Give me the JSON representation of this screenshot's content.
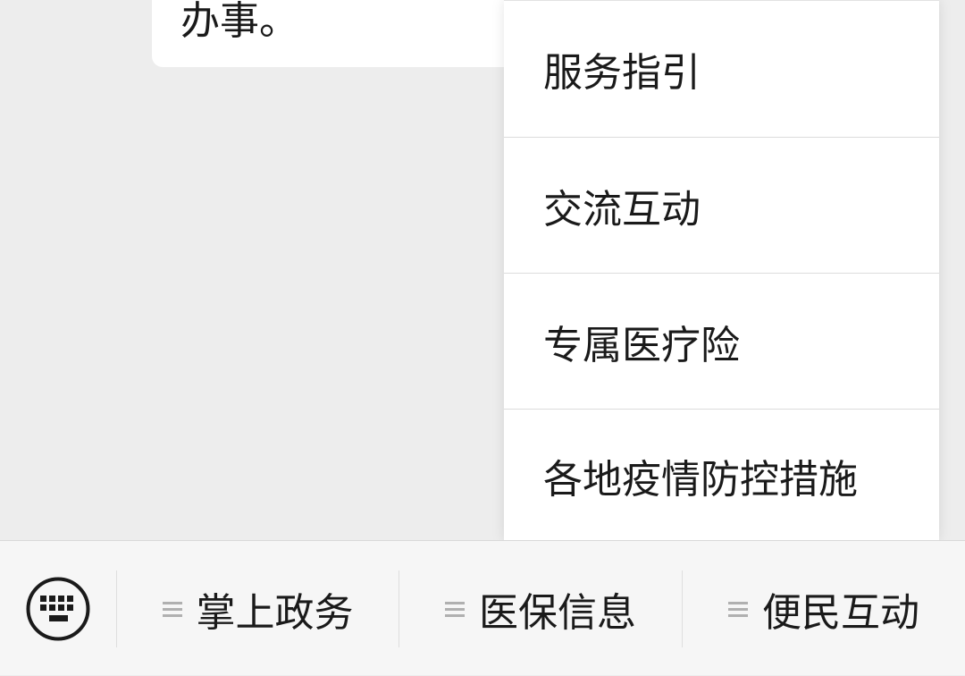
{
  "chat": {
    "bubble_text": "办事。"
  },
  "popup_menu": {
    "items": [
      {
        "label": "服务指引"
      },
      {
        "label": "交流互动"
      },
      {
        "label": "专属医疗险"
      },
      {
        "label": "各地疫情防控措施"
      }
    ]
  },
  "bottom_bar": {
    "keyboard_icon": "keyboard-icon",
    "tabs": [
      {
        "label": "掌上政务",
        "icon": "menu-lines-icon"
      },
      {
        "label": "医保信息",
        "icon": "menu-lines-icon"
      },
      {
        "label": "便民互动",
        "icon": "menu-lines-icon"
      }
    ]
  },
  "colors": {
    "background": "#ededed",
    "bubble": "#ffffff",
    "bar_background": "#f6f6f6",
    "text": "#1a1a1a",
    "icon_gray": "#b0b0b0"
  }
}
